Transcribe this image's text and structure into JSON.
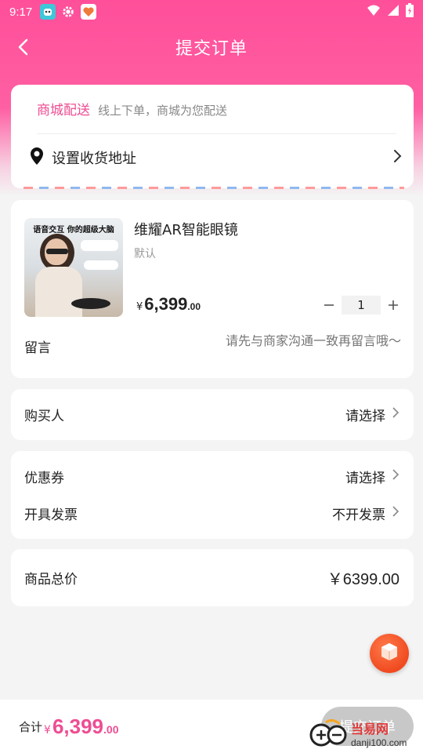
{
  "status_bar": {
    "time": "9:17"
  },
  "header": {
    "title": "提交订单"
  },
  "delivery": {
    "tag": "商城配送",
    "description": "线上下单，商城为您配送",
    "address_label": "设置收货地址"
  },
  "product": {
    "name": "维耀AR智能眼镜",
    "spec": "默认",
    "thumb_caption": "语音交互 你的超级大脑",
    "price_symbol": "¥",
    "price_int": "6,399",
    "price_dec": ".00",
    "quantity": "1",
    "message_label": "留言",
    "message_placeholder": "请先与商家沟通一致再留言哦～"
  },
  "buyer": {
    "label": "购买人",
    "value": "请选择"
  },
  "coupon": {
    "label": "优惠券",
    "value": "请选择"
  },
  "invoice": {
    "label": "开具发票",
    "value": "不开发票"
  },
  "total": {
    "label": "商品总价",
    "value": "￥6399.00"
  },
  "bottom_bar": {
    "sum_label": "合计",
    "price_symbol": "¥",
    "price_int": "6,399",
    "price_dec": ".00",
    "submit_label": "提交订单"
  },
  "watermark": {
    "name": "当易网",
    "url": "danji100.com"
  },
  "colors": {
    "brand_pink": "#ff4f9a",
    "accent_text": "#ee4d93",
    "disabled_button": "#c8c8c8"
  }
}
